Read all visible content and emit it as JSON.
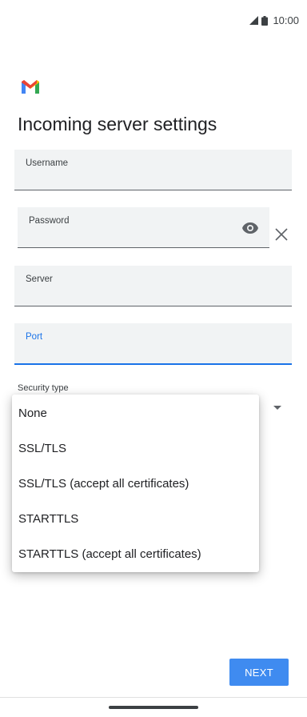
{
  "status_bar": {
    "time": "10:00",
    "icons": [
      "signal-icon",
      "battery-icon"
    ]
  },
  "app": {
    "logo": "gmail-logo",
    "title": "Incoming server settings"
  },
  "form": {
    "username": {
      "label": "Username",
      "value": ""
    },
    "password": {
      "label": "Password",
      "value": "",
      "toggle_icon": "eye-icon"
    },
    "clear_icon": "close-icon",
    "server": {
      "label": "Server",
      "value": ""
    },
    "port": {
      "label": "Port",
      "value": ""
    },
    "security_type": {
      "label": "Security type",
      "options": [
        "None",
        "SSL/TLS",
        "SSL/TLS (accept all certificates)",
        "STARTTLS",
        "STARTTLS (accept all certificates)"
      ]
    }
  },
  "actions": {
    "next_label": "NEXT"
  },
  "colors": {
    "accent": "#1a73e8",
    "button": "#3f8bf0",
    "field_bg": "#f1f3f4"
  }
}
